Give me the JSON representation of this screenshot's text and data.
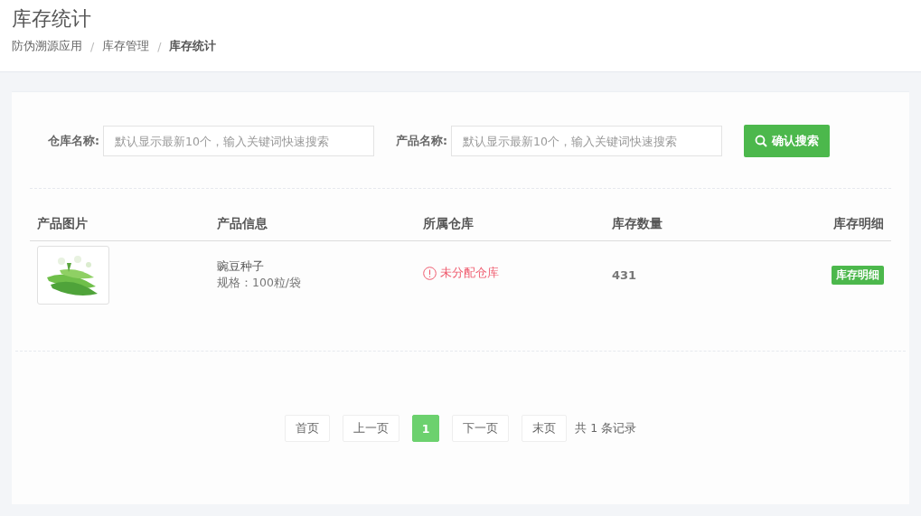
{
  "page_title": "库存统计",
  "breadcrumb": [
    {
      "label": "防伪溯源应用",
      "current": false
    },
    {
      "separator": "/",
      "label": "库存管理",
      "current": false
    },
    {
      "separator": "/",
      "label": "库存统计",
      "current": true
    }
  ],
  "filters": [
    {
      "label": "仓库名称:",
      "placeholder": "默认显示最新10个，输入关键词快速搜索"
    },
    {
      "label": "产品名称:",
      "placeholder": "默认显示最新10个，输入关键词快速搜索"
    }
  ],
  "search_button": "确认搜索",
  "table": {
    "columns": [
      "产品图片",
      "产品信息",
      "所属仓库",
      "库存数量",
      "库存明细"
    ],
    "rows": [
      {
        "name": "豌豆种子",
        "spec": "规格：100粒/袋",
        "warehouse": "未分配仓库",
        "warehouse_unassigned": true,
        "quantity": "431",
        "detail_button": "库存明细"
      }
    ]
  },
  "pagination": {
    "items": [
      {
        "label": "首页",
        "selected": false
      },
      {
        "label": "上一页",
        "selected": false
      },
      {
        "label": "1",
        "selected": true
      },
      {
        "label": "下一页",
        "selected": false
      },
      {
        "label": "末页",
        "selected": false
      }
    ],
    "total": "共 1 条记录"
  }
}
